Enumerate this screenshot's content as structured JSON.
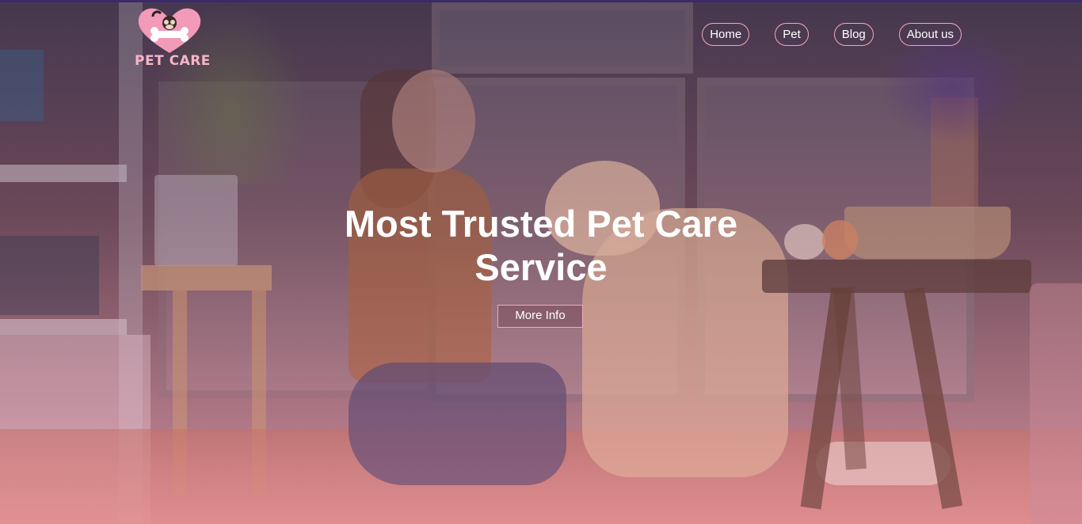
{
  "brand": {
    "logo_text": "PET CARE",
    "colors": {
      "logo_heart": "#f29bb8",
      "logo_text": "#f5b5c8",
      "nav_border": "#f4a8bd",
      "hero_text": "#ffffff",
      "top_border": "#3a2a6a"
    }
  },
  "nav": {
    "items": [
      {
        "label": "Home"
      },
      {
        "label": "Pet"
      },
      {
        "label": "Blog"
      },
      {
        "label": "About us"
      }
    ]
  },
  "hero": {
    "title": "Most Trusted Pet Care Service",
    "cta_label": "More Info"
  },
  "icons": {
    "logo": "heart-bone-dog-logo-icon"
  }
}
